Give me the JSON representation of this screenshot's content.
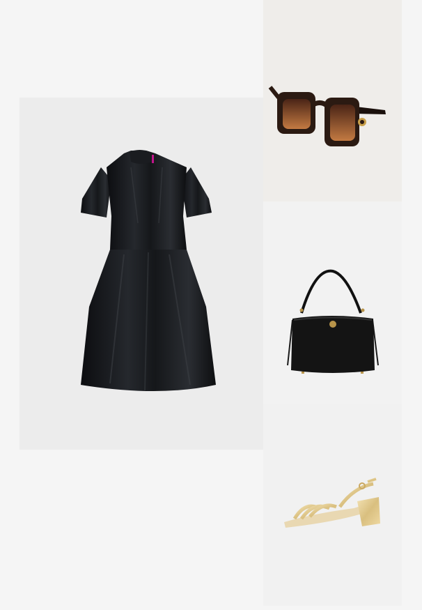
{
  "items": [
    {
      "name": "black-satin-dress",
      "bg": "#ececec"
    },
    {
      "name": "tortoiseshell-sunglasses",
      "bg": "#efedea"
    },
    {
      "name": "black-shoulder-bag",
      "bg": "#f2f2f2"
    },
    {
      "name": "gold-strappy-sandal",
      "bg": "#f1f1f1"
    }
  ]
}
